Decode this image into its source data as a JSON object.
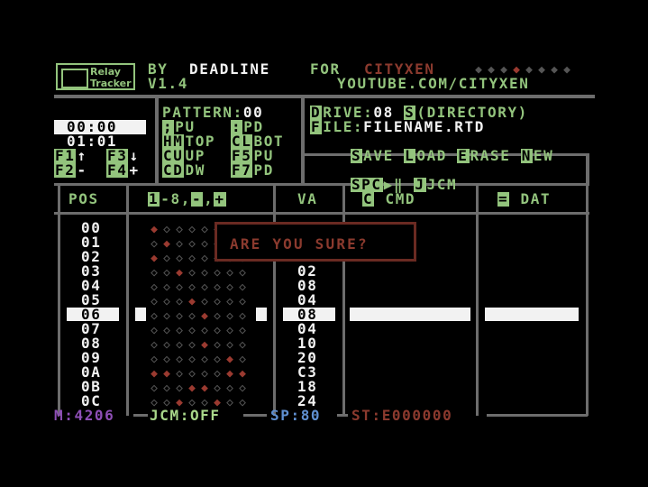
{
  "header": {
    "logo_line1": "Relay",
    "logo_line2": "Tracker",
    "by": "BY",
    "author": "DEADLINE",
    "for": "FOR",
    "for_name": "CITYXEN",
    "version": "V1.4",
    "url": "YOUTUBE.COM/CITYXEN",
    "relay_states": [
      false,
      false,
      false,
      true,
      false,
      false,
      false,
      false
    ]
  },
  "timers": {
    "time": "00:00",
    "sub": "01:01"
  },
  "fkeys": [
    {
      "key": "F1",
      "label": "↑"
    },
    {
      "key": "F3",
      "label": "↓"
    },
    {
      "key": "F2",
      "label": "-"
    },
    {
      "key": "F4",
      "label": "+"
    }
  ],
  "pattern": {
    "label": "PATTERN:",
    "value": "00",
    "commands": [
      {
        "key": ";",
        "text": "PU"
      },
      {
        "key": ":",
        "text": "PD"
      },
      {
        "key": "HM",
        "text": "TOP"
      },
      {
        "key": "CL",
        "text": "BOT"
      },
      {
        "key": "CU",
        "text": "UP"
      },
      {
        "key": "F5",
        "text": "PU"
      },
      {
        "key": "CD",
        "text": "DW"
      },
      {
        "key": "F7",
        "text": "PD"
      }
    ]
  },
  "drive": {
    "label": "RIVE:",
    "key": "D",
    "value": "08",
    "dir_key": "S",
    "dir_text": "(DIRECTORY)",
    "file_key": "F",
    "file_label": "ILE:",
    "filename": "FILENAME.RTD",
    "actions": [
      {
        "key": "S",
        "text": "AVE"
      },
      {
        "key": "L",
        "text": "OAD"
      },
      {
        "key": "E",
        "text": "RASE"
      },
      {
        "key": "N",
        "text": "EW"
      }
    ]
  },
  "transport": {
    "spc_key": "SPC",
    "spc_icon": "▶‖",
    "j_key": "J",
    "j_text": "JCM"
  },
  "columns": {
    "pos": "POS",
    "relay_key1": "1",
    "relay_range": "-8,",
    "relay_key2": "-",
    "relay_comma": ",",
    "relay_key3": "+",
    "va": "VA",
    "cmd_key": "C",
    "cmd": "CMD",
    "dat_key": "=",
    "dat": "DAT"
  },
  "rows": [
    {
      "pos": "00",
      "va": "",
      "relays": [
        true,
        false,
        false,
        false,
        false,
        false,
        false,
        false
      ]
    },
    {
      "pos": "01",
      "va": "",
      "relays": [
        false,
        true,
        false,
        false,
        false,
        false,
        false,
        false
      ]
    },
    {
      "pos": "02",
      "va": "",
      "relays": [
        true,
        false,
        false,
        false,
        false,
        false,
        false,
        false
      ]
    },
    {
      "pos": "03",
      "va": "02",
      "relays": [
        false,
        false,
        true,
        false,
        false,
        false,
        false,
        false
      ]
    },
    {
      "pos": "04",
      "va": "08",
      "relays": [
        false,
        false,
        false,
        false,
        false,
        false,
        false,
        false
      ]
    },
    {
      "pos": "05",
      "va": "04",
      "relays": [
        false,
        false,
        false,
        true,
        false,
        false,
        false,
        false
      ]
    },
    {
      "pos": "06",
      "va": "08",
      "relays": [
        false,
        false,
        false,
        false,
        true,
        false,
        false,
        false
      ]
    },
    {
      "pos": "07",
      "va": "04",
      "relays": [
        false,
        false,
        false,
        false,
        false,
        false,
        false,
        false
      ]
    },
    {
      "pos": "08",
      "va": "10",
      "relays": [
        false,
        false,
        false,
        false,
        true,
        false,
        false,
        false
      ]
    },
    {
      "pos": "09",
      "va": "20",
      "relays": [
        false,
        false,
        false,
        false,
        false,
        false,
        true,
        false
      ]
    },
    {
      "pos": "0A",
      "va": "C3",
      "relays": [
        true,
        true,
        false,
        false,
        false,
        false,
        true,
        true
      ]
    },
    {
      "pos": "0B",
      "va": "18",
      "relays": [
        false,
        false,
        false,
        true,
        true,
        false,
        false,
        false
      ]
    },
    {
      "pos": "0C",
      "va": "24",
      "relays": [
        false,
        false,
        true,
        false,
        false,
        true,
        false,
        false
      ]
    }
  ],
  "selected_row": 6,
  "dialog": {
    "message": "ARE YOU SURE?"
  },
  "status": {
    "mem_label": "M:",
    "mem_value": "4206",
    "jcm_label": "JCM:",
    "jcm_value": "OFF",
    "sp_label": "SP:",
    "sp_value": "80",
    "st_label": "ST:",
    "st_value": "E000000"
  },
  "colors": {
    "background": "#000000",
    "accent_green": "#93c47d",
    "relay_on": "#9a3a30",
    "relay_off": "#555555",
    "dialog_text": "#8b3a2e",
    "frame_grey": "#6d6d6d"
  }
}
